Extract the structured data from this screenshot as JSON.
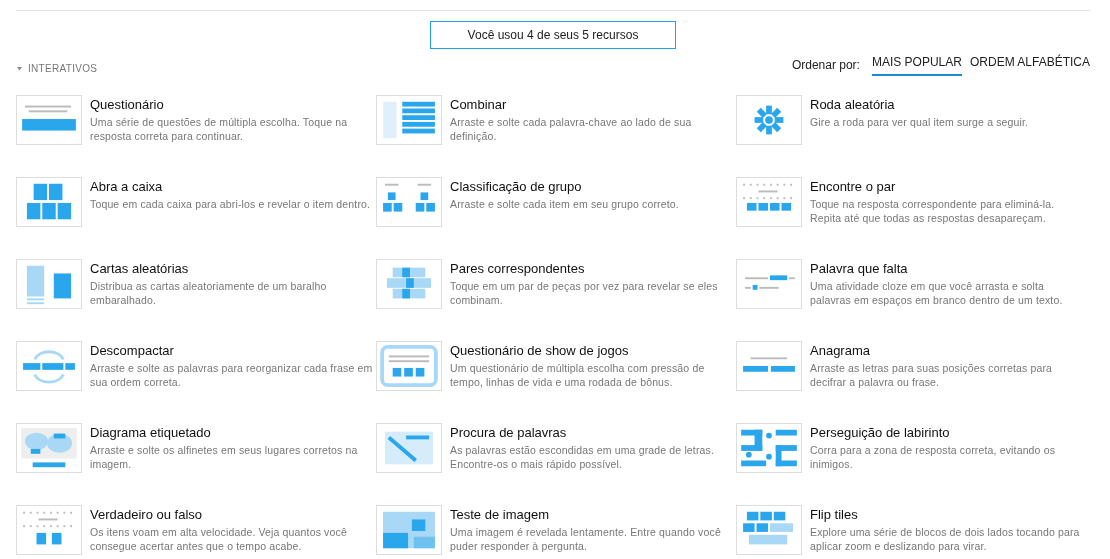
{
  "usage_banner": "Você usou 4 de seus 5 recursos",
  "section": {
    "title": "INTERATIVOS",
    "expanded": true
  },
  "sort": {
    "label": "Ordenar por:",
    "options": [
      {
        "label": "MAIS POPULAR",
        "selected": true
      },
      {
        "label": "ORDEM ALFABÉTICA",
        "selected": false
      }
    ]
  },
  "templates": [
    {
      "kind": "quiz",
      "title": "Questionário",
      "description": "Uma série de questões de múltipla escolha. Toque na resposta correta para continuar."
    },
    {
      "kind": "match",
      "title": "Combinar",
      "description": "Arraste e solte cada palavra-chave ao lado de sua definição."
    },
    {
      "kind": "wheel",
      "title": "Roda aleatória",
      "description": "Gire a roda para ver qual item surge a seguir."
    },
    {
      "kind": "boxes",
      "title": "Abra a caixa",
      "description": "Toque em cada caixa para abri-los e revelar o item dentro."
    },
    {
      "kind": "groups",
      "title": "Classificação de grupo",
      "description": "Arraste e solte cada item em seu grupo correto."
    },
    {
      "kind": "pairs",
      "title": "Encontre o par",
      "description": "Toque na resposta correspondente para eliminá-la. Repita até que todas as respostas desapareçam."
    },
    {
      "kind": "cards",
      "title": "Cartas aleatórias",
      "description": "Distribua as cartas aleatoriamente de um baralho embaralhado."
    },
    {
      "kind": "tiles",
      "title": "Pares correspondentes",
      "description": "Toque em um par de peças por vez para revelar se eles combinam."
    },
    {
      "kind": "cloze",
      "title": "Palavra que falta",
      "description": "Uma atividade cloze em que você arrasta e solta palavras em espaços em branco dentro de um texto."
    },
    {
      "kind": "unjumble",
      "title": "Descompactar",
      "description": "Arraste e solte as palavras para reorganizar cada frase em sua ordem correta."
    },
    {
      "kind": "gameshow",
      "title": "Questionário de show de jogos",
      "description": "Um questionário de múltipla escolha com pressão de tempo, linhas de vida e uma rodada de bônus."
    },
    {
      "kind": "anagram",
      "title": "Anagrama",
      "description": "Arraste as letras para suas posições corretas para decifrar a palavra ou frase."
    },
    {
      "kind": "map",
      "title": "Diagrama etiquetado",
      "description": "Arraste e solte os alfinetes em seus lugares corretos na imagem."
    },
    {
      "kind": "wordsearch",
      "title": "Procura de palavras",
      "description": "As palavras estão escondidas em uma grade de letras. Encontre-os o mais rápido possível."
    },
    {
      "kind": "maze",
      "title": "Perseguição de labirinto",
      "description": "Corra para a zona de resposta correta, evitando os inimigos."
    },
    {
      "kind": "truefalse",
      "title": "Verdadeiro ou falso",
      "description": "Os itens voam em alta velocidade. Veja quantos você consegue acertar antes que o tempo acabe."
    },
    {
      "kind": "image",
      "title": "Teste de imagem",
      "description": "Uma imagem é revelada lentamente. Entre quando você puder responder à pergunta."
    },
    {
      "kind": "flip",
      "title": "Flip tiles",
      "description": "Explore uma série de blocos de dois lados tocando para aplicar zoom e deslizando para virar."
    }
  ]
}
